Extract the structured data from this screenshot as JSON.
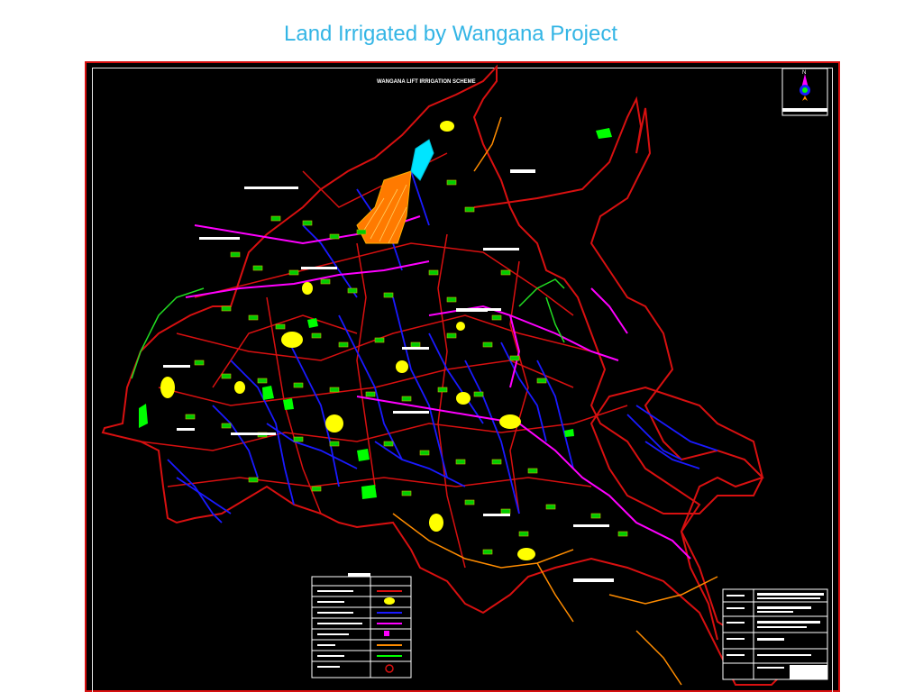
{
  "slide": {
    "title": "Land Irrigated by Wangana Project"
  },
  "map": {
    "background": "#000000",
    "frame_color": "#d81010",
    "header_label": "WANGANA LIFT IRRIGATION SCHEME",
    "compass_letter": "N",
    "colors": {
      "boundary": "#d81010",
      "canal": "#ff00ff",
      "drainage": "#1a1aff",
      "road": "#ff8c00",
      "village": "#ffff00",
      "forest": "#00ff00",
      "label_box": "#c8b400",
      "label_fill": "#00cc00",
      "irrigated_patch": "#ff7a00",
      "reservoir": "#00e5ff"
    }
  }
}
